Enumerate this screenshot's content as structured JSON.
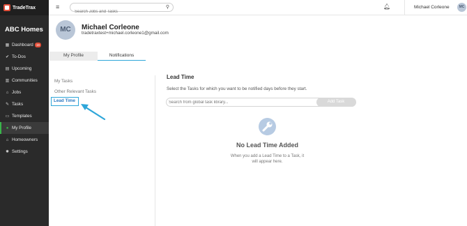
{
  "brand": {
    "name": "TradeTrax"
  },
  "sidebar": {
    "company": "ABC Homes",
    "items": [
      {
        "label": "Dashboard",
        "icon": "grid-icon",
        "badge": "19"
      },
      {
        "label": "To-Dos",
        "icon": "check-circle-icon"
      },
      {
        "label": "Upcoming",
        "icon": "calendar-icon"
      },
      {
        "label": "Communities",
        "icon": "map-icon"
      },
      {
        "label": "Jobs",
        "icon": "home-icon"
      },
      {
        "label": "Tasks",
        "icon": "wrench-icon"
      },
      {
        "label": "Templates",
        "icon": "document-icon"
      },
      {
        "label": "My Profile",
        "icon": "user-icon",
        "active": true
      },
      {
        "label": "Homeowners",
        "icon": "house-user-icon"
      },
      {
        "label": "Settings",
        "icon": "gear-icon"
      }
    ]
  },
  "topbar": {
    "search_placeholder": "Search Jobs and Tasks",
    "user_name": "Michael Corleone",
    "user_initials": "MC"
  },
  "profile": {
    "initials": "MC",
    "name": "Michael Corleone",
    "email": "tradetraxtest+michael.corleone1@gmail.com"
  },
  "tabs": [
    {
      "label": "My Profile",
      "active": false
    },
    {
      "label": "Notifications",
      "active": true
    }
  ],
  "notif_menu": {
    "items": [
      "My Tasks",
      "Other Relevant Tasks",
      "Lead Time"
    ],
    "selected": "Lead Time"
  },
  "lead_time": {
    "title": "Lead Time",
    "description": "Select the Tasks for which you want to be notified days before they start.",
    "search_placeholder": "Search from global task library...",
    "add_label": "Add Task",
    "empty_title": "No Lead Time Added",
    "empty_desc": "When you add a Lead Time to a Task, it will appear here."
  },
  "colors": {
    "sidebar_bg": "#2a2a2a",
    "accent_green": "#39b54a",
    "accent_blue": "#2ea6d9",
    "badge_red": "#e04e39"
  }
}
